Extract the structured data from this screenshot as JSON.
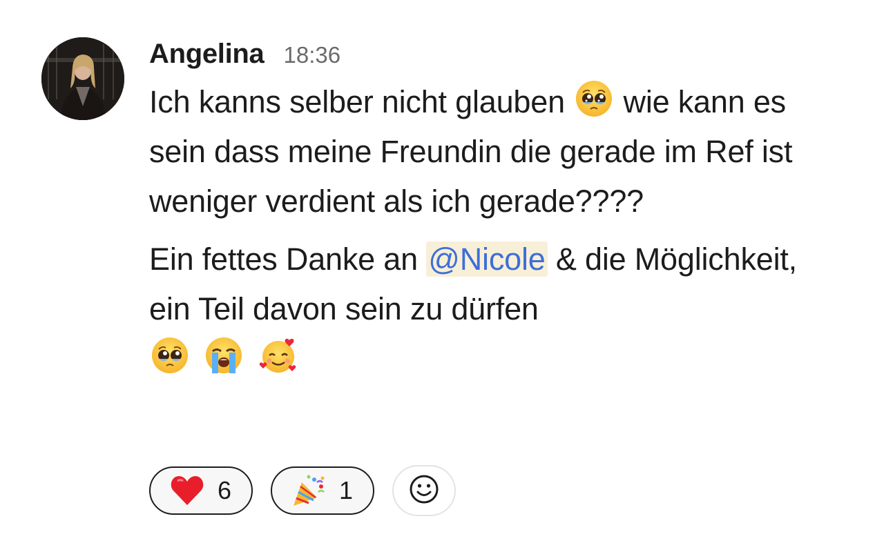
{
  "message": {
    "author": "Angelina",
    "time": "18:36",
    "paragraph1": {
      "text_a": "Ich kanns selber nicht glauben",
      "emoji_a": "pleading-face-emoji",
      "text_b": "wie kann es sein dass meine Freundin die gerade im Ref ist weniger verdient als ich gerade????"
    },
    "paragraph2": {
      "text_a": "Ein fettes Danke an",
      "mention": "@Nicole",
      "text_b": "& die Möglichkeit, ein Teil davon sein zu dürfen",
      "emojis": [
        "pleading-face-emoji",
        "loudly-crying-face-emoji",
        "smiling-face-with-hearts-emoji"
      ]
    }
  },
  "reactions": [
    {
      "icon": "red-heart-emoji",
      "count": "6"
    },
    {
      "icon": "party-popper-emoji",
      "count": "1"
    }
  ],
  "add_reaction": {
    "icon": "add-emoji-reaction-icon"
  },
  "colors": {
    "text": "#1d1c1d",
    "timestamp": "#6b6a6b",
    "mention_text": "#3d6fd8",
    "mention_bg": "#f8efd8",
    "reaction_border": "#1d1c1d"
  }
}
